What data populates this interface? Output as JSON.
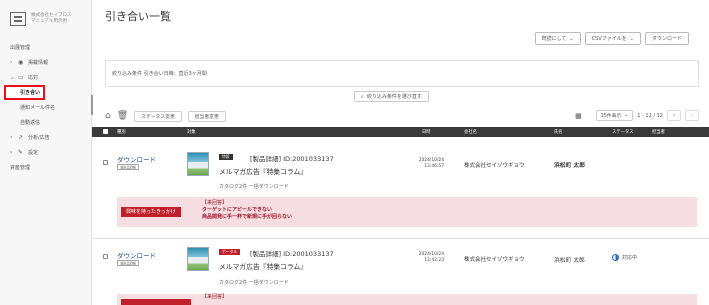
{
  "sidebar": {
    "logo_line1": "株式会社セイブロス",
    "logo_line2": "マニュアル用示例",
    "items": [
      {
        "label": "出展管理",
        "chevron": "",
        "icon": ""
      },
      {
        "label": "掲載情報",
        "chevron": ">",
        "icon": "globe-icon"
      },
      {
        "label": "応対",
        "chevron": "⌄",
        "icon": "chat-icon"
      },
      {
        "label": "引き合い",
        "sub": true,
        "active": true
      },
      {
        "label": "通知メール件名",
        "sub": true
      },
      {
        "label": "自動返信",
        "sub": true
      },
      {
        "label": "分析/広告",
        "chevron": ">",
        "icon": "chart-icon"
      },
      {
        "label": "設定",
        "chevron": ">",
        "icon": "wrench-icon"
      },
      {
        "label": "資産管理",
        "chevron": "",
        "icon": ""
      }
    ]
  },
  "header": {
    "title": "引き合い一覧",
    "btn_bulk": "既読にして",
    "btn_csv": "CSVファイルを",
    "btn_download": "ダウンロード"
  },
  "filter": {
    "text": "絞り込み条件 引き合い日時：直近3ヶ月間",
    "button": "絞り込み条件を選び直す"
  },
  "toolbar": {
    "status_change": "ステータス変更",
    "assignee_change": "担当者変更",
    "per_page": "15件表示",
    "pagination": "1 - 12 / 12"
  },
  "table": {
    "headers": {
      "type": "種別",
      "target": "対象",
      "date": "日時",
      "company": "会社名",
      "name": "氏名",
      "status": "ステータス",
      "assignee": "担当者"
    },
    "rows": [
      {
        "type": "ダウンロード",
        "type_tag": "資料詳細",
        "badge": "特設",
        "badge_color": "#333333",
        "item_id": "[製品詳細] ID:2001033137",
        "item_name": "メルマガ広告『特集コラム』",
        "item_sub": "カタログ2件 一括ダウンロード",
        "date": "2024/10/24",
        "time": "13:46:57",
        "company": "株式会社セイゾウギョウ",
        "person": "浜松町 太郎",
        "status": "",
        "note_tag": "興味を持ったきっかけ",
        "note_lines": [
          "【来回答】",
          "ターゲットにアピールできない",
          "商品開発に手一杯で新規に手が回らない"
        ]
      },
      {
        "type": "ダウンロード",
        "type_tag": "資料詳細",
        "badge": "ポータル",
        "badge_color": "#c0202a",
        "item_id": "[製品詳細] ID:2001033137",
        "item_name": "メルマガ広告『特集コラム』",
        "item_sub": "カタログ2件 一括ダウンロード",
        "date": "2024/10/24",
        "time": "13:42:23",
        "company": "株式会社セイゾウギョウ",
        "person": "浜松町 太郎",
        "status": "対応中",
        "note_tag": "",
        "note_lines": [
          "【来回答】"
        ]
      }
    ]
  }
}
